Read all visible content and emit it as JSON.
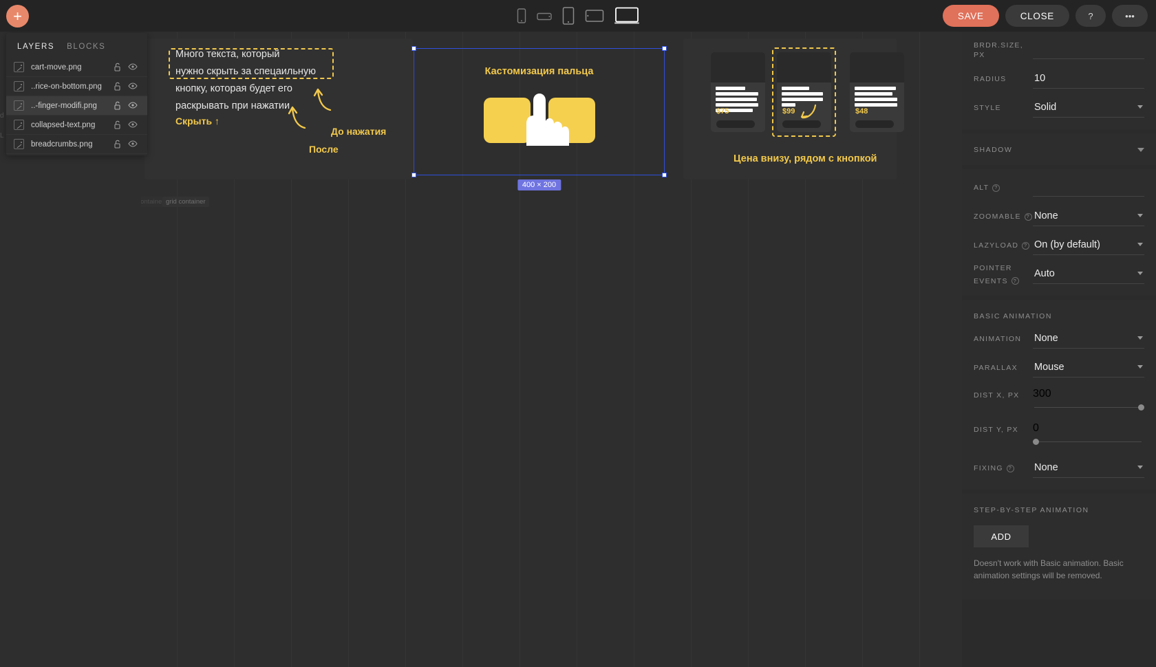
{
  "topbar": {
    "add_button": "+",
    "devices": [
      {
        "name": "mobile-portrait",
        "selected": false
      },
      {
        "name": "mobile-landscape",
        "selected": false
      },
      {
        "name": "tablet-portrait",
        "selected": false
      },
      {
        "name": "tablet-landscape",
        "selected": false
      },
      {
        "name": "desktop",
        "selected": true
      }
    ],
    "save_label": "SAVE",
    "close_label": "CLOSE",
    "help_label": "?",
    "more_label": "•••"
  },
  "layers": {
    "tab_layers": "LAYERS",
    "tab_blocks": "BLOCKS",
    "items": [
      {
        "name": "cart-move.png",
        "selected": false
      },
      {
        "name": "..rice-on-bottom.png",
        "selected": false
      },
      {
        "name": "..-finger-modifi.png",
        "selected": true
      },
      {
        "name": "collapsed-text.png",
        "selected": false
      },
      {
        "name": "breadcrumbs.png",
        "selected": false
      }
    ]
  },
  "canvas": {
    "left_board": {
      "boxed_lines": [
        "Много текста, который",
        "нужно скрыть за  спецаильную"
      ],
      "rest_lines": [
        "кнопку, которая будет его",
        "раскрывать при нажатии"
      ],
      "hide_label": "Скрыть ↑",
      "before_label": "До нажатия",
      "after_label": "После"
    },
    "selected_element": {
      "title": "Кастомизация пальца",
      "size_badge": "400 × 200"
    },
    "right_board": {
      "cards": [
        {
          "price": "$75",
          "highlighted": false
        },
        {
          "price": "$99",
          "highlighted": true
        },
        {
          "price": "$48",
          "highlighted": false
        }
      ],
      "caption": "Цена внизу, рядом с кнопкой"
    },
    "container_tags": [
      "window container",
      "grid container"
    ]
  },
  "props": {
    "border": {
      "size_label": "BRDR.SIZE, PX",
      "size_value": "",
      "radius_label": "RADIUS",
      "radius_value": "10",
      "style_label": "STYLE",
      "style_value": "Solid"
    },
    "shadow": {
      "title": "SHADOW"
    },
    "image": {
      "alt_label": "ALT",
      "alt_value": "",
      "zoomable_label": "ZOOMABLE",
      "zoomable_value": "None",
      "lazyload_label": "LAZYLOAD",
      "lazyload_value": "On (by default)",
      "pointer_label_1": "POINTER",
      "pointer_label_2": "EVENTS",
      "pointer_value": "Auto"
    },
    "basic_animation": {
      "title": "BASIC ANIMATION",
      "animation_label": "ANIMATION",
      "animation_value": "None",
      "parallax_label": "PARALLAX",
      "parallax_value": "Mouse",
      "dist_x_label": "DIST X, PX",
      "dist_x_value": "300",
      "dist_y_label": "DIST Y, PX",
      "dist_y_value": "0",
      "fixing_label": "FIXING",
      "fixing_value": "None"
    },
    "step_animation": {
      "title": "STEP-BY-STEP ANIMATION",
      "add_label": "ADD",
      "hint": "Doesn't work with Basic animation. Basic animation settings will be removed."
    }
  },
  "colors": {
    "accent_orange": "#e0715a",
    "accent_yellow": "#f2c94c",
    "selection_blue": "#2f4fe0",
    "badge_purple": "#6f74e0"
  }
}
